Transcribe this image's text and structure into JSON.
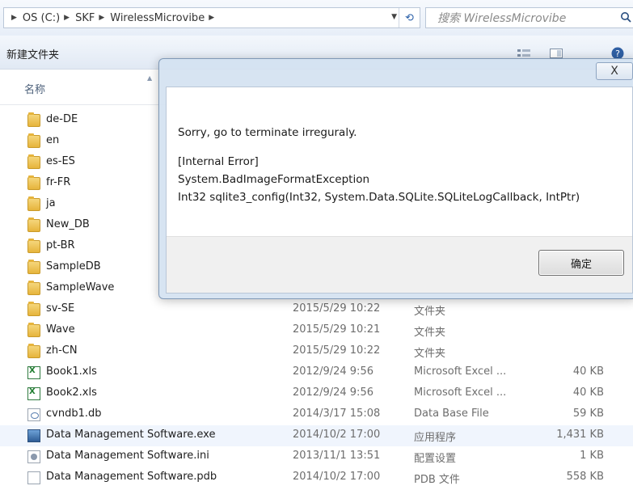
{
  "address_bar": {
    "crumbs": [
      "OS (C:)",
      "SKF",
      "WirelessMicrovibe"
    ],
    "search_placeholder": "搜索 WirelessMicrovibe"
  },
  "toolbar": {
    "new_folder_label": "新建文件夹"
  },
  "columns": {
    "name_label": "名称"
  },
  "files": [
    {
      "name": "de-DE",
      "date": "",
      "type": "",
      "size": "",
      "icon": "folder-icon"
    },
    {
      "name": "en",
      "date": "",
      "type": "",
      "size": "",
      "icon": "folder-icon"
    },
    {
      "name": "es-ES",
      "date": "",
      "type": "",
      "size": "",
      "icon": "folder-icon"
    },
    {
      "name": "fr-FR",
      "date": "",
      "type": "",
      "size": "",
      "icon": "folder-icon"
    },
    {
      "name": "ja",
      "date": "",
      "type": "",
      "size": "",
      "icon": "folder-icon"
    },
    {
      "name": "New_DB",
      "date": "",
      "type": "",
      "size": "",
      "icon": "folder-icon"
    },
    {
      "name": "pt-BR",
      "date": "",
      "type": "",
      "size": "",
      "icon": "folder-icon"
    },
    {
      "name": "SampleDB",
      "date": "",
      "type": "",
      "size": "",
      "icon": "folder-icon"
    },
    {
      "name": "SampleWave",
      "date": "",
      "type": "",
      "size": "",
      "icon": "folder-icon"
    },
    {
      "name": "sv-SE",
      "date": "2015/5/29 10:22",
      "type": "文件夹",
      "size": "",
      "icon": "folder-icon"
    },
    {
      "name": "Wave",
      "date": "2015/5/29 10:21",
      "type": "文件夹",
      "size": "",
      "icon": "folder-icon"
    },
    {
      "name": "zh-CN",
      "date": "2015/5/29 10:22",
      "type": "文件夹",
      "size": "",
      "icon": "folder-icon"
    },
    {
      "name": "Book1.xls",
      "date": "2012/9/24 9:56",
      "type": "Microsoft Excel ...",
      "size": "40 KB",
      "icon": "excel-icon"
    },
    {
      "name": "Book2.xls",
      "date": "2012/9/24 9:56",
      "type": "Microsoft Excel ...",
      "size": "40 KB",
      "icon": "excel-icon"
    },
    {
      "name": "cvndb1.db",
      "date": "2014/3/17 15:08",
      "type": "Data Base File",
      "size": "59 KB",
      "icon": "db-icon"
    },
    {
      "name": "Data Management Software.exe",
      "date": "2014/10/2 17:00",
      "type": "应用程序",
      "size": "1,431 KB",
      "icon": "exe-icon",
      "selected": true
    },
    {
      "name": "Data Management Software.ini",
      "date": "2013/11/1 13:51",
      "type": "配置设置",
      "size": "1 KB",
      "icon": "ini-icon"
    },
    {
      "name": "Data Management Software.pdb",
      "date": "2014/10/2 17:00",
      "type": "PDB 文件",
      "size": "558 KB",
      "icon": "pdb-icon"
    }
  ],
  "dialog": {
    "close_label": "X",
    "message": "Sorry, go to terminate irreguraly.",
    "error_heading": "[Internal Error]",
    "exception": "System.BadImageFormatException",
    "signature": "Int32 sqlite3_config(Int32, System.Data.SQLite.SQLiteLogCallback, IntPtr)",
    "ok_label": "确定"
  }
}
